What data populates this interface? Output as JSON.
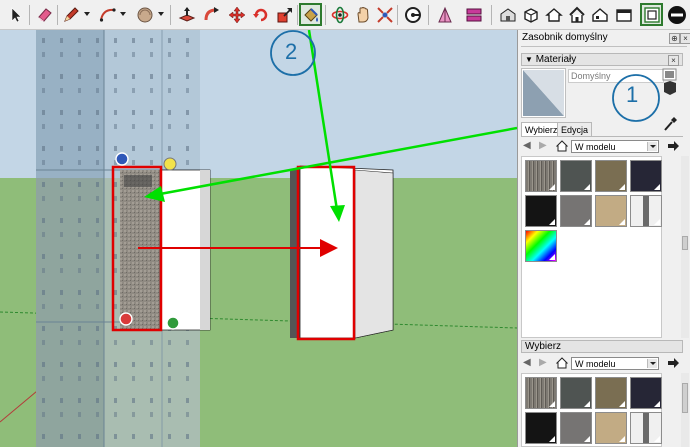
{
  "app": {
    "accent": "#2e7a2e",
    "annotation_colors": {
      "arrow_green": "#00e000",
      "frame_red": "#e00000",
      "circle_blue": "#1c6fa8"
    }
  },
  "toolbar": {
    "icons": [
      "select-icon",
      "eraser-icon",
      "pencil-icon",
      "arc-icon",
      "shape-icon",
      "push-pull-icon",
      "follow-me-icon",
      "move-icon",
      "rotate-icon",
      "scale-icon",
      "paint-bucket-icon",
      "orbit-icon",
      "pan-icon",
      "zoom-extents-icon",
      "tape-measure-icon",
      "section-plane-icon",
      "layers-icon",
      "warehouse-icon",
      "component-icon",
      "house-icon",
      "home-icon",
      "house-2-icon",
      "box-icon",
      "stop-icon"
    ]
  },
  "viewport": {
    "annotations": {
      "label_1": "1",
      "label_2": "2"
    }
  },
  "tray": {
    "title": "Zasobnik domyślny",
    "close": "×",
    "pin": "⊕",
    "materials": {
      "header": "Materiały",
      "material_name": "Domyślny",
      "tabs": [
        {
          "label": "Wybierz"
        },
        {
          "label": "Edycja"
        }
      ],
      "location": "W modelu",
      "swatches": [
        {
          "color": "#7e7a73",
          "kind": "texture"
        },
        {
          "color": "#4f5452",
          "kind": "solid"
        },
        {
          "color": "#7a6e52",
          "kind": "solid"
        },
        {
          "color": "#262636",
          "kind": "solid"
        },
        {
          "color": "#141414",
          "kind": "solid"
        },
        {
          "color": "#767473",
          "kind": "solid"
        },
        {
          "color": "#c2ab84",
          "kind": "solid"
        },
        {
          "color": "#6a6a6a",
          "kind": "panel"
        },
        {
          "color": "#ffffff",
          "kind": "rainbow"
        }
      ]
    },
    "secondary": {
      "header": "Wybierz",
      "location": "W modelu",
      "swatches": [
        {
          "color": "#7e7a73",
          "kind": "texture"
        },
        {
          "color": "#4f5452",
          "kind": "solid"
        },
        {
          "color": "#7a6e52",
          "kind": "solid"
        },
        {
          "color": "#262636",
          "kind": "solid"
        },
        {
          "color": "#141414",
          "kind": "solid"
        },
        {
          "color": "#767473",
          "kind": "solid"
        },
        {
          "color": "#c2ab84",
          "kind": "solid"
        },
        {
          "color": "#6a6a6a",
          "kind": "panel"
        }
      ]
    }
  }
}
